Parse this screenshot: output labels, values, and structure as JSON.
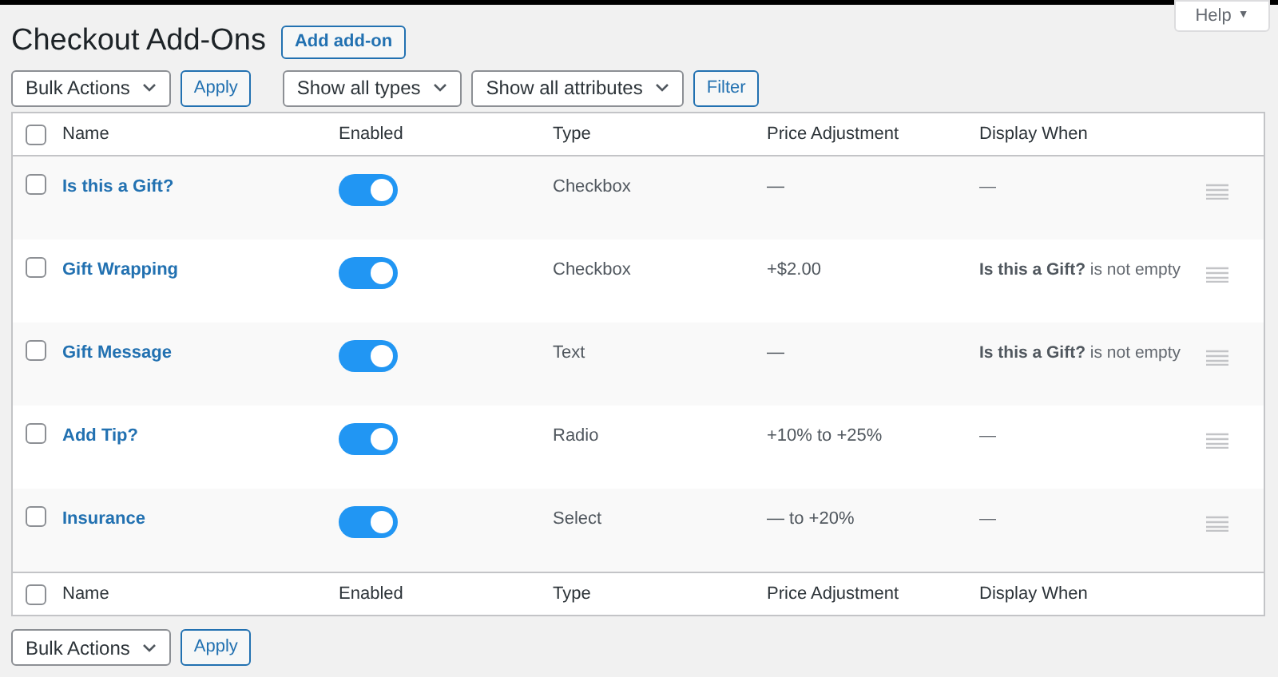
{
  "page": {
    "title": "Checkout Add-Ons",
    "add_button": "Add add-on",
    "help_button": "Help",
    "help_arrow": "▼"
  },
  "top_toolbar": {
    "bulk_actions": "Bulk Actions",
    "apply": "Apply",
    "type_filter": "Show all types",
    "attribute_filter": "Show all attributes",
    "filter": "Filter"
  },
  "table": {
    "columns": [
      "Name",
      "Enabled",
      "Type",
      "Price Adjustment",
      "Display When"
    ],
    "rows": [
      {
        "name": "Is this a Gift?",
        "checked": false,
        "enabled": true,
        "type": "Checkbox",
        "price": "—",
        "display_when": "—"
      },
      {
        "name": "Gift Wrapping",
        "checked": false,
        "enabled": true,
        "type": "Checkbox",
        "price": "+$2.00",
        "display_when": "**Is this a Gift?** is not empty"
      },
      {
        "name": "Gift Message",
        "checked": false,
        "enabled": true,
        "type": "Text",
        "price": "—",
        "display_when": "**Is this a Gift?** is not empty"
      },
      {
        "name": "Add Tip?",
        "checked": false,
        "enabled": true,
        "type": "Radio",
        "price": "+10% to +25%",
        "display_when": "—"
      },
      {
        "name": "Insurance",
        "checked": false,
        "enabled": true,
        "type": "Select",
        "price": "— to +20%",
        "display_when": "—"
      }
    ],
    "select_all_checked": false,
    "footer_select_all_checked": false,
    "footer_columns": [
      "Name",
      "Enabled",
      "Type",
      "Price Adjustment",
      "Display When"
    ]
  },
  "bottom_toolbar": {
    "bulk_actions": "Bulk Actions",
    "apply": "Apply"
  }
}
